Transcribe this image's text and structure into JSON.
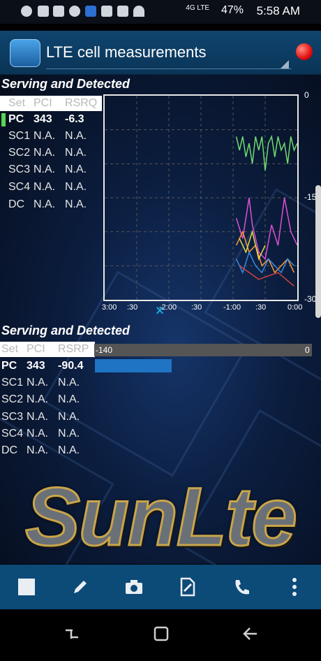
{
  "status_bar": {
    "network": "4G LTE",
    "battery_percent": "47%",
    "time": "5:58 AM",
    "icons": [
      "app-a-icon",
      "unknown-icon",
      "image-icon",
      "people-icon",
      "cellinfo-icon",
      "lock-icon",
      "play-icon",
      "wifi-icon"
    ]
  },
  "app_bar": {
    "title": "LTE cell measurements",
    "logo_icon": "phone-signal-icon",
    "record_indicator_color": "#e01010"
  },
  "section1": {
    "title": "Serving and Detected",
    "columns": [
      "Set",
      "PCI",
      "RSRQ"
    ],
    "rows": [
      {
        "set": "PC",
        "pci": "343",
        "val": "-6.3"
      },
      {
        "set": "SC1",
        "pci": "N.A.",
        "val": "N.A."
      },
      {
        "set": "SC2",
        "pci": "N.A.",
        "val": "N.A."
      },
      {
        "set": "SC3",
        "pci": "N.A.",
        "val": "N.A."
      },
      {
        "set": "SC4",
        "pci": "N.A.",
        "val": "N.A."
      },
      {
        "set": "DC",
        "pci": "N.A.",
        "val": "N.A."
      }
    ]
  },
  "chart_data": {
    "type": "line",
    "x_ticks": [
      "3:00",
      ":30",
      "-2:00",
      ":30",
      "-1:00",
      ":30",
      "0:00"
    ],
    "y_ticks": [
      "0",
      "-15",
      "-30"
    ],
    "ylim": [
      -30,
      0
    ],
    "series": [
      {
        "color": "#6fdc6f",
        "x": [
          -0.95,
          -0.9,
          -0.85,
          -0.8,
          -0.75,
          -0.7,
          -0.65,
          -0.6,
          -0.55,
          -0.5,
          -0.45,
          -0.4,
          -0.35,
          -0.3,
          -0.25,
          -0.2,
          -0.15,
          -0.1,
          -0.05,
          0
        ],
        "values": [
          -6,
          -8,
          -6,
          -9,
          -7,
          -10,
          -6,
          -8,
          -6,
          -11,
          -7,
          -6,
          -9,
          -6,
          -8,
          -7,
          -10,
          -6,
          -8,
          -7
        ]
      },
      {
        "color": "#e04fd4",
        "x": [
          -0.95,
          -0.85,
          -0.75,
          -0.7,
          -0.6,
          -0.5,
          -0.4,
          -0.3,
          -0.2,
          -0.1,
          0
        ],
        "values": [
          -18,
          -21,
          -15,
          -19,
          -23,
          -24,
          -19,
          -22,
          -15,
          -20,
          -22
        ]
      },
      {
        "color": "#ff9933",
        "x": [
          -0.95,
          -0.85,
          -0.75,
          -0.65,
          -0.55,
          -0.45,
          -0.35,
          -0.25,
          -0.15,
          -0.05
        ],
        "values": [
          -22,
          -20,
          -23,
          -22,
          -25,
          -24,
          -26,
          -25,
          -24,
          -26
        ]
      },
      {
        "color": "#3a8be0",
        "x": [
          -0.95,
          -0.85,
          -0.75,
          -0.65,
          -0.55,
          -0.45,
          -0.35,
          -0.25,
          -0.15,
          -0.05
        ],
        "values": [
          -24,
          -26,
          -23,
          -25,
          -26,
          -24,
          -25,
          -26,
          -24,
          -25
        ]
      },
      {
        "color": "#e6d84a",
        "x": [
          -0.9,
          -0.8,
          -0.7,
          -0.6,
          -0.5
        ],
        "values": [
          -21,
          -23,
          -20,
          -24,
          -22
        ]
      },
      {
        "color": "#d04040",
        "x": [
          -0.9,
          -0.6,
          -0.3,
          -0.05
        ],
        "values": [
          -25,
          -27,
          -26,
          -28
        ]
      }
    ]
  },
  "section2": {
    "title": "Serving and Detected",
    "columns": [
      "Set",
      "PCI",
      "RSRP"
    ],
    "bar_min_label": "-140",
    "bar_max_label": "0",
    "rows": [
      {
        "set": "PC",
        "pci": "343",
        "val": "-90.4",
        "fraction": 0.354
      },
      {
        "set": "SC1",
        "pci": "N.A.",
        "val": "N.A."
      },
      {
        "set": "SC2",
        "pci": "N.A.",
        "val": "N.A."
      },
      {
        "set": "SC3",
        "pci": "N.A.",
        "val": "N.A."
      },
      {
        "set": "SC4",
        "pci": "N.A.",
        "val": "N.A."
      },
      {
        "set": "DC",
        "pci": "N.A.",
        "val": "N.A."
      }
    ]
  },
  "logo_text": "SunLte",
  "toolbar": {
    "buttons": [
      "stop-icon",
      "pencil-icon",
      "camera-icon",
      "edit-document-icon",
      "phone-icon",
      "more-vert-icon"
    ]
  },
  "nav_bar": {
    "buttons": [
      "recent-apps-icon",
      "home-icon",
      "back-icon"
    ]
  }
}
